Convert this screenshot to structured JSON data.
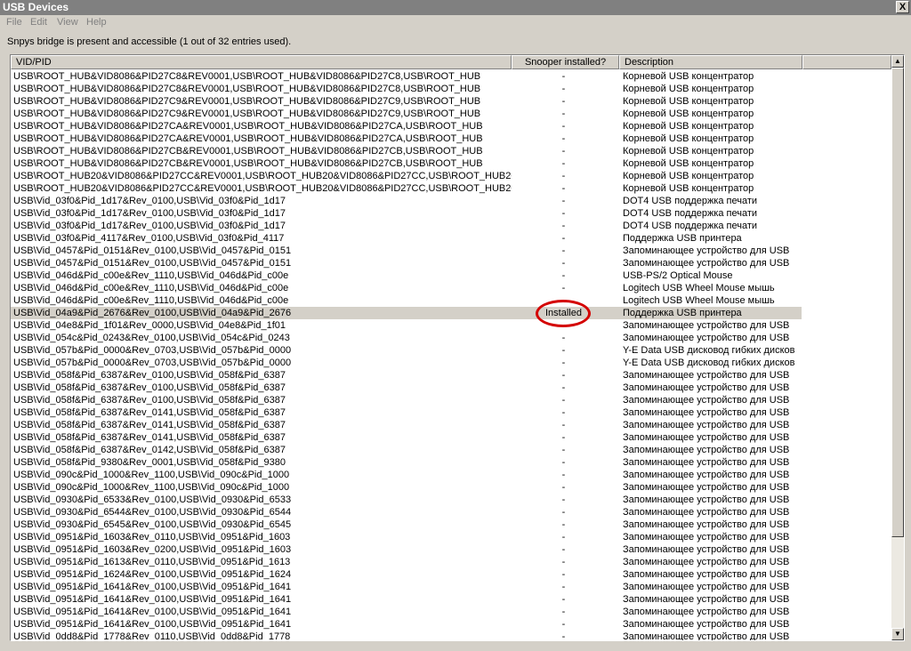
{
  "window": {
    "title": "USB Devices",
    "close_glyph": "X"
  },
  "menu": [
    "File",
    "Edit",
    "View",
    "Help"
  ],
  "status": "Snpys bridge is present and accessible (1 out of 32 entries used).",
  "columns": {
    "vidpid": "VID/PID",
    "snooper": "Snooper installed?",
    "description": "Description"
  },
  "rows": [
    {
      "vid": "USB\\ROOT_HUB&VID8086&PID27C8&REV0001,USB\\ROOT_HUB&VID8086&PID27C8,USB\\ROOT_HUB",
      "snoop": "-",
      "desc": "Корневой USB концентратор"
    },
    {
      "vid": "USB\\ROOT_HUB&VID8086&PID27C8&REV0001,USB\\ROOT_HUB&VID8086&PID27C8,USB\\ROOT_HUB",
      "snoop": "-",
      "desc": "Корневой USB концентратор"
    },
    {
      "vid": "USB\\ROOT_HUB&VID8086&PID27C9&REV0001,USB\\ROOT_HUB&VID8086&PID27C9,USB\\ROOT_HUB",
      "snoop": "-",
      "desc": "Корневой USB концентратор"
    },
    {
      "vid": "USB\\ROOT_HUB&VID8086&PID27C9&REV0001,USB\\ROOT_HUB&VID8086&PID27C9,USB\\ROOT_HUB",
      "snoop": "-",
      "desc": "Корневой USB концентратор"
    },
    {
      "vid": "USB\\ROOT_HUB&VID8086&PID27CA&REV0001,USB\\ROOT_HUB&VID8086&PID27CA,USB\\ROOT_HUB",
      "snoop": "-",
      "desc": "Корневой USB концентратор"
    },
    {
      "vid": "USB\\ROOT_HUB&VID8086&PID27CA&REV0001,USB\\ROOT_HUB&VID8086&PID27CA,USB\\ROOT_HUB",
      "snoop": "-",
      "desc": "Корневой USB концентратор"
    },
    {
      "vid": "USB\\ROOT_HUB&VID8086&PID27CB&REV0001,USB\\ROOT_HUB&VID8086&PID27CB,USB\\ROOT_HUB",
      "snoop": "-",
      "desc": "Корневой USB концентратор"
    },
    {
      "vid": "USB\\ROOT_HUB&VID8086&PID27CB&REV0001,USB\\ROOT_HUB&VID8086&PID27CB,USB\\ROOT_HUB",
      "snoop": "-",
      "desc": "Корневой USB концентратор"
    },
    {
      "vid": "USB\\ROOT_HUB20&VID8086&PID27CC&REV0001,USB\\ROOT_HUB20&VID8086&PID27CC,USB\\ROOT_HUB20",
      "snoop": "-",
      "desc": "Корневой USB концентратор"
    },
    {
      "vid": "USB\\ROOT_HUB20&VID8086&PID27CC&REV0001,USB\\ROOT_HUB20&VID8086&PID27CC,USB\\ROOT_HUB20",
      "snoop": "-",
      "desc": "Корневой USB концентратор"
    },
    {
      "vid": "USB\\Vid_03f0&Pid_1d17&Rev_0100,USB\\Vid_03f0&Pid_1d17",
      "snoop": "-",
      "desc": "DOT4 USB поддержка печати"
    },
    {
      "vid": "USB\\Vid_03f0&Pid_1d17&Rev_0100,USB\\Vid_03f0&Pid_1d17",
      "snoop": "-",
      "desc": "DOT4 USB поддержка печати"
    },
    {
      "vid": "USB\\Vid_03f0&Pid_1d17&Rev_0100,USB\\Vid_03f0&Pid_1d17",
      "snoop": "-",
      "desc": "DOT4 USB поддержка печати"
    },
    {
      "vid": "USB\\Vid_03f0&Pid_4117&Rev_0100,USB\\Vid_03f0&Pid_4117",
      "snoop": "-",
      "desc": "Поддержка USB принтера"
    },
    {
      "vid": "USB\\Vid_0457&Pid_0151&Rev_0100,USB\\Vid_0457&Pid_0151",
      "snoop": "-",
      "desc": "Запоминающее устройство для USB"
    },
    {
      "vid": "USB\\Vid_0457&Pid_0151&Rev_0100,USB\\Vid_0457&Pid_0151",
      "snoop": "-",
      "desc": "Запоминающее устройство для USB"
    },
    {
      "vid": "USB\\Vid_046d&Pid_c00e&Rev_1110,USB\\Vid_046d&Pid_c00e",
      "snoop": "-",
      "desc": "USB-PS/2 Optical Mouse"
    },
    {
      "vid": "USB\\Vid_046d&Pid_c00e&Rev_1110,USB\\Vid_046d&Pid_c00e",
      "snoop": "-",
      "desc": "Logitech USB Wheel Mouse мышь"
    },
    {
      "vid": "USB\\Vid_046d&Pid_c00e&Rev_1110,USB\\Vid_046d&Pid_c00e",
      "snoop": "-",
      "desc": "Logitech USB Wheel Mouse мышь"
    },
    {
      "vid": "USB\\Vid_04a9&Pid_2676&Rev_0100,USB\\Vid_04a9&Pid_2676",
      "snoop": "Installed",
      "desc": "Поддержка USB принтера",
      "selected": true
    },
    {
      "vid": "USB\\Vid_04e8&Pid_1f01&Rev_0000,USB\\Vid_04e8&Pid_1f01",
      "snoop": "-",
      "desc": "Запоминающее устройство для USB"
    },
    {
      "vid": "USB\\Vid_054c&Pid_0243&Rev_0100,USB\\Vid_054c&Pid_0243",
      "snoop": "-",
      "desc": "Запоминающее устройство для USB"
    },
    {
      "vid": "USB\\Vid_057b&Pid_0000&Rev_0703,USB\\Vid_057b&Pid_0000",
      "snoop": "-",
      "desc": "Y-E Data USB дисковод гибких дисков"
    },
    {
      "vid": "USB\\Vid_057b&Pid_0000&Rev_0703,USB\\Vid_057b&Pid_0000",
      "snoop": "-",
      "desc": "Y-E Data USB дисковод гибких дисков"
    },
    {
      "vid": "USB\\Vid_058f&Pid_6387&Rev_0100,USB\\Vid_058f&Pid_6387",
      "snoop": "-",
      "desc": "Запоминающее устройство для USB"
    },
    {
      "vid": "USB\\Vid_058f&Pid_6387&Rev_0100,USB\\Vid_058f&Pid_6387",
      "snoop": "-",
      "desc": "Запоминающее устройство для USB"
    },
    {
      "vid": "USB\\Vid_058f&Pid_6387&Rev_0100,USB\\Vid_058f&Pid_6387",
      "snoop": "-",
      "desc": "Запоминающее устройство для USB"
    },
    {
      "vid": "USB\\Vid_058f&Pid_6387&Rev_0141,USB\\Vid_058f&Pid_6387",
      "snoop": "-",
      "desc": "Запоминающее устройство для USB"
    },
    {
      "vid": "USB\\Vid_058f&Pid_6387&Rev_0141,USB\\Vid_058f&Pid_6387",
      "snoop": "-",
      "desc": "Запоминающее устройство для USB"
    },
    {
      "vid": "USB\\Vid_058f&Pid_6387&Rev_0141,USB\\Vid_058f&Pid_6387",
      "snoop": "-",
      "desc": "Запоминающее устройство для USB"
    },
    {
      "vid": "USB\\Vid_058f&Pid_6387&Rev_0142,USB\\Vid_058f&Pid_6387",
      "snoop": "-",
      "desc": "Запоминающее устройство для USB"
    },
    {
      "vid": "USB\\Vid_058f&Pid_9380&Rev_0001,USB\\Vid_058f&Pid_9380",
      "snoop": "-",
      "desc": "Запоминающее устройство для USB"
    },
    {
      "vid": "USB\\Vid_090c&Pid_1000&Rev_1100,USB\\Vid_090c&Pid_1000",
      "snoop": "-",
      "desc": "Запоминающее устройство для USB"
    },
    {
      "vid": "USB\\Vid_090c&Pid_1000&Rev_1100,USB\\Vid_090c&Pid_1000",
      "snoop": "-",
      "desc": "Запоминающее устройство для USB"
    },
    {
      "vid": "USB\\Vid_0930&Pid_6533&Rev_0100,USB\\Vid_0930&Pid_6533",
      "snoop": "-",
      "desc": "Запоминающее устройство для USB"
    },
    {
      "vid": "USB\\Vid_0930&Pid_6544&Rev_0100,USB\\Vid_0930&Pid_6544",
      "snoop": "-",
      "desc": "Запоминающее устройство для USB"
    },
    {
      "vid": "USB\\Vid_0930&Pid_6545&Rev_0100,USB\\Vid_0930&Pid_6545",
      "snoop": "-",
      "desc": "Запоминающее устройство для USB"
    },
    {
      "vid": "USB\\Vid_0951&Pid_1603&Rev_0110,USB\\Vid_0951&Pid_1603",
      "snoop": "-",
      "desc": "Запоминающее устройство для USB"
    },
    {
      "vid": "USB\\Vid_0951&Pid_1603&Rev_0200,USB\\Vid_0951&Pid_1603",
      "snoop": "-",
      "desc": "Запоминающее устройство для USB"
    },
    {
      "vid": "USB\\Vid_0951&Pid_1613&Rev_0110,USB\\Vid_0951&Pid_1613",
      "snoop": "-",
      "desc": "Запоминающее устройство для USB"
    },
    {
      "vid": "USB\\Vid_0951&Pid_1624&Rev_0100,USB\\Vid_0951&Pid_1624",
      "snoop": "-",
      "desc": "Запоминающее устройство для USB"
    },
    {
      "vid": "USB\\Vid_0951&Pid_1641&Rev_0100,USB\\Vid_0951&Pid_1641",
      "snoop": "-",
      "desc": "Запоминающее устройство для USB"
    },
    {
      "vid": "USB\\Vid_0951&Pid_1641&Rev_0100,USB\\Vid_0951&Pid_1641",
      "snoop": "-",
      "desc": "Запоминающее устройство для USB"
    },
    {
      "vid": "USB\\Vid_0951&Pid_1641&Rev_0100,USB\\Vid_0951&Pid_1641",
      "snoop": "-",
      "desc": "Запоминающее устройство для USB"
    },
    {
      "vid": "USB\\Vid_0951&Pid_1641&Rev_0100,USB\\Vid_0951&Pid_1641",
      "snoop": "-",
      "desc": "Запоминающее устройство для USB"
    },
    {
      "vid": "USB\\Vid_0dd8&Pid_1778&Rev_0110,USB\\Vid_0dd8&Pid_1778",
      "snoop": "-",
      "desc": "Запоминающее устройство для USB"
    }
  ],
  "icons": {
    "scroll_up": "scroll-up-arrow-icon",
    "scroll_down": "scroll-down-arrow-icon"
  },
  "colors": {
    "highlight_circle": "#d40000",
    "titlebar": "#808080",
    "face": "#d4d0c8"
  }
}
